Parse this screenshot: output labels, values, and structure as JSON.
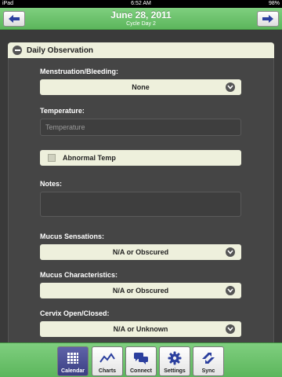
{
  "status_bar": {
    "carrier": "iPad",
    "time": "6:52 AM",
    "battery": "98%"
  },
  "header": {
    "title": "June 28, 2011",
    "subtitle": "Cycle Day 2",
    "prev_icon": "arrow-left-icon",
    "next_icon": "arrow-right-icon",
    "accent_color": "#5cb65c"
  },
  "section": {
    "title": "Daily Observation",
    "collapse_icon": "minus-circle-icon"
  },
  "form": {
    "menstruation": {
      "label": "Menstruation/Bleeding:",
      "value": "None"
    },
    "temperature": {
      "label": "Temperature:",
      "placeholder": "Temperature",
      "value": ""
    },
    "abnormal_temp": {
      "label": "Abnormal Temp",
      "checked": false
    },
    "notes": {
      "label": "Notes:",
      "value": ""
    },
    "mucus_sensations": {
      "label": "Mucus Sensations:",
      "value": "N/A or Obscured"
    },
    "mucus_characteristics": {
      "label": "Mucus Characteristics:",
      "value": "N/A or Obscured"
    },
    "cervix": {
      "label": "Cervix Open/Closed:",
      "value": "N/A or Unknown"
    }
  },
  "tabs": [
    {
      "label": "Calendar",
      "icon": "calendar-grid-icon",
      "active": true
    },
    {
      "label": "Charts",
      "icon": "line-chart-icon",
      "active": false
    },
    {
      "label": "Connect",
      "icon": "chat-bubbles-icon",
      "active": false
    },
    {
      "label": "Settings",
      "icon": "gear-icon",
      "active": false
    },
    {
      "label": "Sync",
      "icon": "sync-icon",
      "active": false
    }
  ]
}
